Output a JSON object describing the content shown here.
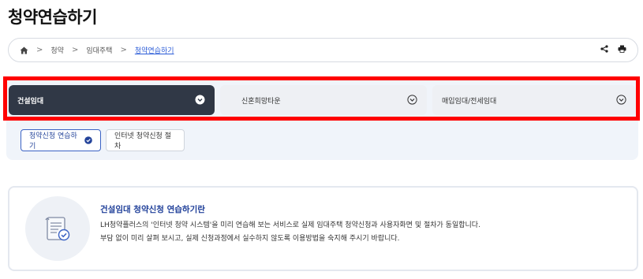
{
  "page": {
    "title": "청약연습하기"
  },
  "breadcrumb": {
    "home_icon": "home-icon",
    "items": [
      "청약",
      "임대주택"
    ],
    "current": "청약연습하기",
    "actions": [
      "share-icon",
      "print-icon"
    ]
  },
  "tabs": [
    {
      "label": "건설임대",
      "active": true
    },
    {
      "label": "신혼희망타운",
      "active": false
    },
    {
      "label": "매입임대/전세임대",
      "active": false
    }
  ],
  "sub_buttons": {
    "primary": "청약신청 연습하기",
    "secondary": "인터넷 청약신청 절차"
  },
  "info": {
    "title": "건설임대 청약신청 연습하기란",
    "line1": "LH청약플러스의 '인터넷 청약 시스템'을 미리 연습해 보는 서비스로 실제 임대주택 청약신청과 사용자화면 및 절차가 동일합니다.",
    "line2": "부담 없이 미리 살펴 보시고, 실제 신청과정에서 실수하지 않도록 이용방법을 숙지해 주시기 바랍니다.",
    "icon": "document-check-icon"
  },
  "colors": {
    "accent": "#2a5bd7",
    "tab_active_bg": "#303846",
    "highlight_frame": "#ff0000",
    "panel_bg": "#f0f4fa"
  }
}
